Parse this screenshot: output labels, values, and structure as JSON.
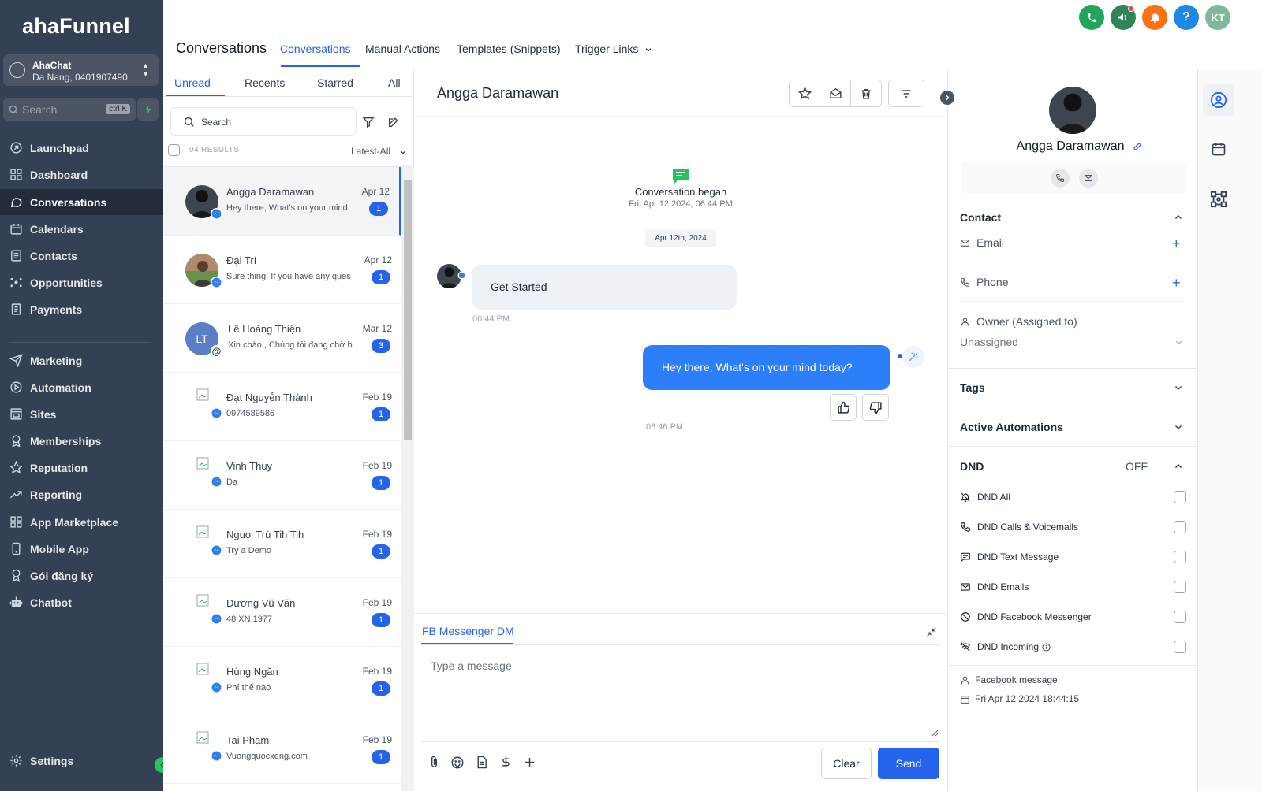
{
  "sidebar": {
    "logo": "ahaFunnel",
    "account": {
      "name": "AhaChat",
      "location": "Da Nang, 0401907490"
    },
    "search": {
      "placeholder": "Search",
      "shortcut": "ctrl K"
    },
    "items": [
      {
        "label": "Launchpad",
        "icon": "rocket-icon"
      },
      {
        "label": "Dashboard",
        "icon": "grid-icon"
      },
      {
        "label": "Conversations",
        "icon": "chat-icon",
        "active": true
      },
      {
        "label": "Calendars",
        "icon": "calendar-icon"
      },
      {
        "label": "Contacts",
        "icon": "contacts-icon"
      },
      {
        "label": "Opportunities",
        "icon": "opportunities-icon"
      },
      {
        "label": "Payments",
        "icon": "payments-icon"
      },
      {
        "label": "Marketing",
        "icon": "send-icon"
      },
      {
        "label": "Automation",
        "icon": "automation-icon"
      },
      {
        "label": "Sites",
        "icon": "sites-icon"
      },
      {
        "label": "Memberships",
        "icon": "memberships-icon"
      },
      {
        "label": "Reputation",
        "icon": "star-icon"
      },
      {
        "label": "Reporting",
        "icon": "trend-icon"
      },
      {
        "label": "App Marketplace",
        "icon": "apps-icon"
      },
      {
        "label": "Mobile App",
        "icon": "mobile-icon"
      },
      {
        "label": "Gói đăng ký",
        "icon": "award-icon"
      },
      {
        "label": "Chatbot",
        "icon": "robot-icon"
      }
    ],
    "settings_label": "Settings"
  },
  "header": {
    "title": "Conversations",
    "tabs": [
      "Conversations",
      "Manual Actions",
      "Templates (Snippets)",
      "Trigger Links"
    ],
    "active_tab": "Conversations",
    "user_initials": "KT",
    "colors": {
      "phone": "#22a55b",
      "megaphone": "#2f855a",
      "bell": "#f97316",
      "help": "#1e88e5",
      "avatar": "#7fb89a"
    }
  },
  "list": {
    "tabs": [
      "Unread",
      "Recents",
      "Starred",
      "All"
    ],
    "active_tab": "Unread",
    "search_placeholder": "Search",
    "results": "94 RESULTS",
    "sort": "Latest-All",
    "conversations": [
      {
        "name": "Angga Daramawan",
        "snippet": "Hey there, What's on your mind",
        "date": "Apr 12",
        "count": "1",
        "avatar": "photo-dark",
        "selected": true
      },
      {
        "name": "Đại Trí",
        "snippet": "Sure thing! If you have any ques",
        "date": "Apr 12",
        "count": "1",
        "avatar": "photo-light"
      },
      {
        "name": "Lê Hoàng Thiện",
        "snippet": "Xin chào , Chúng tôi đang chờ b",
        "date": "Mar 12",
        "count": "3",
        "avatar": "initials",
        "initials": "LT"
      },
      {
        "name": "Đạt Nguyễn Thành",
        "snippet": "0974589586",
        "date": "Feb 19",
        "count": "1",
        "avatar": "broken"
      },
      {
        "name": "Vinh Thuy",
        "snippet": "Dạ",
        "date": "Feb 19",
        "count": "1",
        "avatar": "broken"
      },
      {
        "name": "Nguoi Trù Tih Tih",
        "snippet": "Try a Demo",
        "date": "Feb 19",
        "count": "1",
        "avatar": "broken"
      },
      {
        "name": "Dương Vũ Văn",
        "snippet": "48 XN 1977",
        "date": "Feb 19",
        "count": "1",
        "avatar": "broken"
      },
      {
        "name": "Hùng Ngăn",
        "snippet": "Phí thế nào",
        "date": "Feb 19",
        "count": "1",
        "avatar": "broken"
      },
      {
        "name": "Tai Phạm",
        "snippet": "Vuongquocxeng.com",
        "date": "Feb 19",
        "count": "1",
        "avatar": "broken"
      }
    ]
  },
  "chat": {
    "contact_name": "Angga Daramawan",
    "began_label": "Conversation began",
    "began_date": "Fri, Apr 12 2024, 06:44 PM",
    "date_separator": "Apr 12th, 2024",
    "incoming": {
      "text": "Get Started",
      "time": "06:44 PM"
    },
    "outgoing": {
      "text": "Hey there, What's on your mind today?",
      "time": "06:46 PM"
    },
    "channel": "FB Messenger DM",
    "input_placeholder": "Type a message",
    "clear_label": "Clear",
    "send_label": "Send"
  },
  "contact": {
    "name": "Angga Daramawan",
    "sections": {
      "contact": "Contact",
      "email": "Email",
      "phone": "Phone",
      "owner": "Owner (Assigned to)",
      "owner_value": "Unassigned",
      "tags": "Tags",
      "automations": "Active Automations",
      "dnd": "DND",
      "dnd_state": "OFF"
    },
    "dnd_items": [
      "DND All",
      "DND Calls & Voicemails",
      "DND Text Message",
      "DND Emails",
      "DND Facebook Messenger",
      "DND Incoming"
    ],
    "source": "Facebook message",
    "created": "Fri Apr 12 2024 18:44:15"
  }
}
